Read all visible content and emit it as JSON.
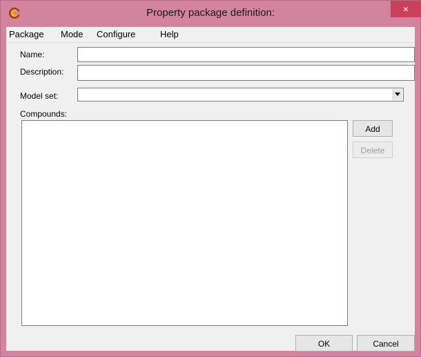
{
  "window": {
    "title": "Property package definition:",
    "close_label": "×",
    "icon": "app-c-icon",
    "accent_color": "#d4839f"
  },
  "menu": {
    "items": [
      {
        "label": "Package"
      },
      {
        "label": "Mode"
      },
      {
        "label": "Configure"
      },
      {
        "label": "Help"
      }
    ]
  },
  "form": {
    "name_label": "Name:",
    "name_value": "",
    "description_label": "Description:",
    "description_value": "",
    "model_set_label": "Model set:",
    "model_set_value": "",
    "compounds_label": "Compounds:"
  },
  "buttons": {
    "add": "Add",
    "delete": "Delete",
    "ok": "OK",
    "cancel": "Cancel"
  }
}
